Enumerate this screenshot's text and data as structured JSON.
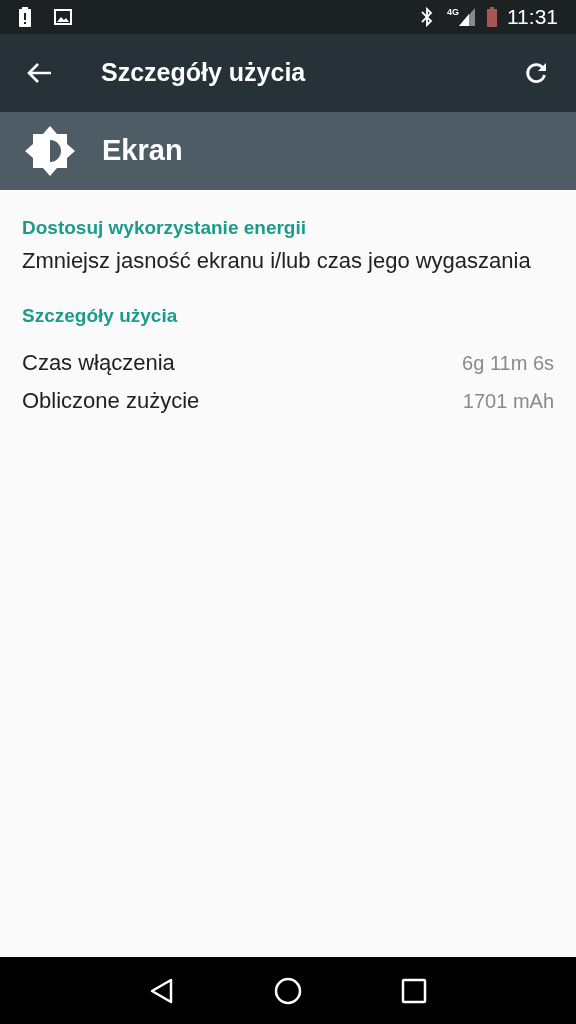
{
  "status_bar": {
    "network": "4G",
    "time": "11:31"
  },
  "toolbar": {
    "title": "Szczegóły użycia"
  },
  "header": {
    "title": "Ekran"
  },
  "sections": [
    {
      "kind": "action",
      "title": "Dostosuj wykorzystanie energii",
      "text": "Zmniejsz jasność ekranu i/lub czas jego wygaszania"
    },
    {
      "kind": "details",
      "title": "Szczegóły użycia",
      "rows": [
        {
          "label": "Czas włączenia",
          "value": "6g 11m 6s"
        },
        {
          "label": "Obliczone zużycie",
          "value": "1701 mAh"
        }
      ]
    }
  ]
}
